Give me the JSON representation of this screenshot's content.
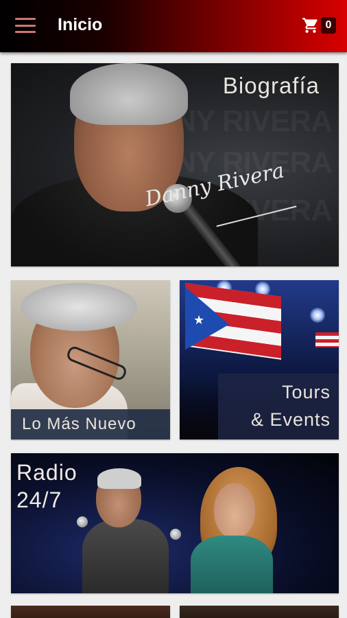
{
  "appbar": {
    "title": "Inicio",
    "menu_icon": "hamburger-menu-icon",
    "cart_icon": "shopping-cart-icon",
    "cart_count": "0"
  },
  "tiles": {
    "biografia": {
      "caption": "Biografía",
      "signature": "Danny Rivera",
      "background_watermark": "DANNY RIVERA"
    },
    "lo_mas_nuevo": {
      "caption": "Lo Más Nuevo"
    },
    "tours": {
      "caption_line1": "Tours",
      "caption_line2": "& Events"
    },
    "radio": {
      "caption_line1": "Radio",
      "caption_line2": "24/7"
    }
  },
  "colors": {
    "appbar_gradient_start": "#000000",
    "appbar_gradient_end": "#d80000",
    "caption_bar": "#202c44",
    "page_background": "#eeeeee"
  }
}
